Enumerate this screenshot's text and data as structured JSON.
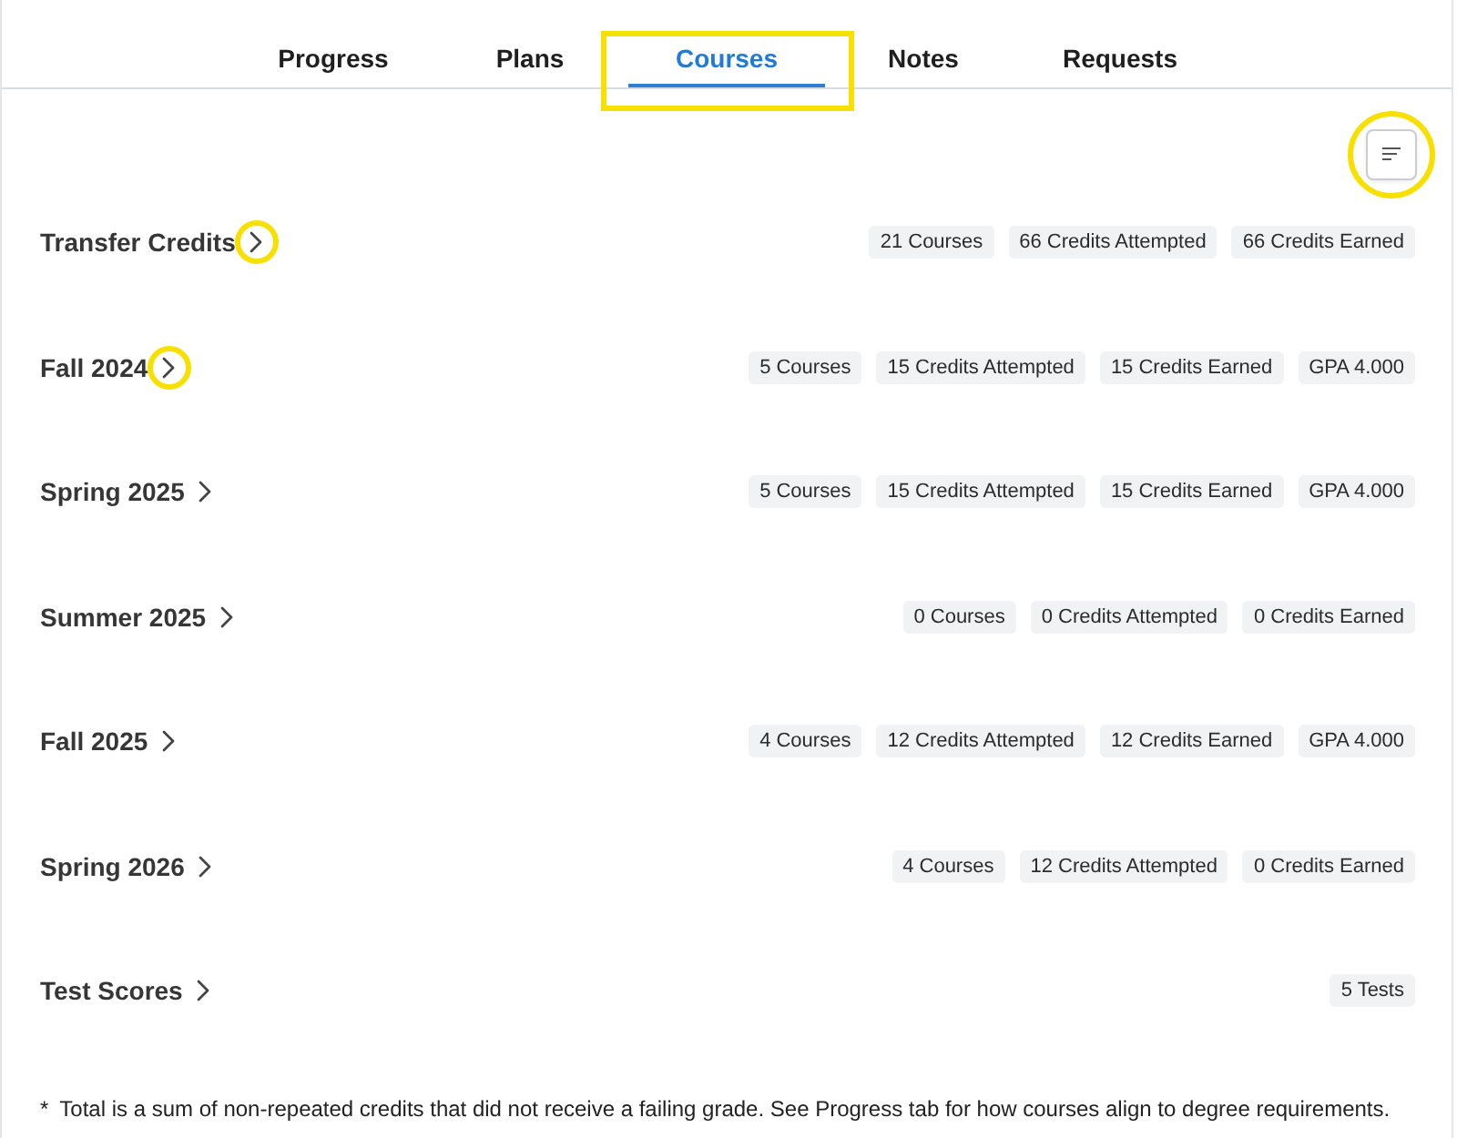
{
  "tabs": [
    {
      "label": "Progress",
      "selected": false,
      "highlighted": false
    },
    {
      "label": "Plans",
      "selected": false,
      "highlighted": false
    },
    {
      "label": "Courses",
      "selected": true,
      "highlighted": true
    },
    {
      "label": "Notes",
      "selected": false,
      "highlighted": false
    },
    {
      "label": "Requests",
      "selected": false,
      "highlighted": false
    }
  ],
  "sort_button": {
    "highlighted": true
  },
  "terms": [
    {
      "title": "Transfer Credits",
      "chevron_highlighted": true,
      "badges": [
        "21 Courses",
        "66 Credits Attempted",
        "66 Credits Earned"
      ]
    },
    {
      "title": "Fall 2024",
      "chevron_highlighted": true,
      "badges": [
        "5 Courses",
        "15 Credits Attempted",
        "15 Credits Earned",
        "GPA 4.000"
      ]
    },
    {
      "title": "Spring 2025",
      "chevron_highlighted": false,
      "badges": [
        "5 Courses",
        "15 Credits Attempted",
        "15 Credits Earned",
        "GPA 4.000"
      ]
    },
    {
      "title": "Summer 2025",
      "chevron_highlighted": false,
      "badges": [
        "0 Courses",
        "0 Credits Attempted",
        "0 Credits Earned"
      ]
    },
    {
      "title": "Fall 2025",
      "chevron_highlighted": false,
      "badges": [
        "4 Courses",
        "12 Credits Attempted",
        "12 Credits Earned",
        "GPA 4.000"
      ]
    },
    {
      "title": "Spring 2026",
      "chevron_highlighted": false,
      "badges": [
        "4 Courses",
        "12 Credits Attempted",
        "0 Credits Earned"
      ]
    },
    {
      "title": "Test Scores",
      "chevron_highlighted": false,
      "badges": [
        "5 Tests"
      ]
    }
  ],
  "footnote": {
    "marker": "*",
    "text": "Total is a sum of non-repeated credits that did not receive a failing grade. See Progress tab for how courses align to degree requirements."
  }
}
